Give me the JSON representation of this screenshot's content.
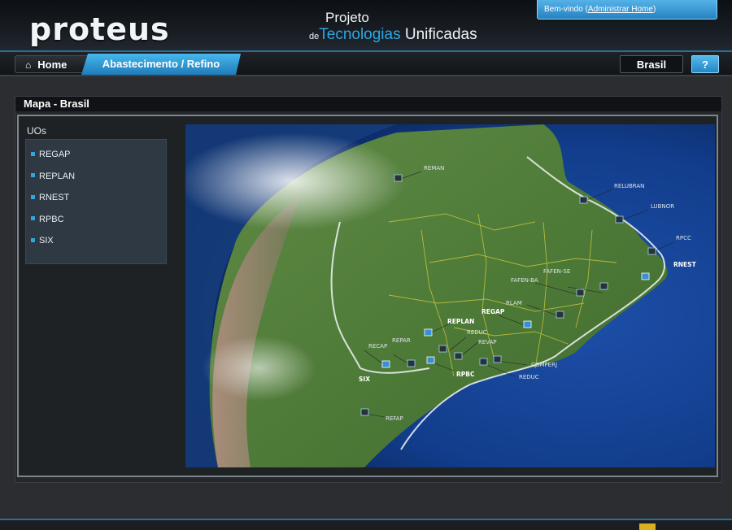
{
  "header": {
    "logo": "proteus",
    "project_line1": "Projeto",
    "project_prefix": "de",
    "project_blue": "Tecnologias",
    "project_rest": " Unificadas",
    "welcome_text": "Bem-vindo (",
    "welcome_link": "Administrar Home",
    "welcome_close": ")"
  },
  "tabs": {
    "home": "Home",
    "active": "Abastecimento / Refino",
    "region": "Brasil",
    "help": "?"
  },
  "panel": {
    "title": "Mapa - Brasil",
    "uos_label": "UOs",
    "uos": [
      "REGAP",
      "REPLAN",
      "RNEST",
      "RPBC",
      "SIX"
    ]
  },
  "map": {
    "markers": [
      "REMAN",
      "RELUBRAN",
      "LUBNOR",
      "RPCC",
      "RNEST",
      "FAFEN-SE",
      "FAFEN-BA",
      "RLAM",
      "REGAP",
      "REPLAN",
      "REDUC",
      "REVAP",
      "RECAP",
      "REPAR",
      "SIX",
      "RPBC",
      "COMPERJ",
      "REDUC",
      "REFAP"
    ]
  },
  "colors": {
    "accent": "#2fa6e2",
    "header_bg": "#0c1014",
    "panel_bg": "#24272b"
  },
  "icons": [
    "home-icon",
    "monitor-pin-icon"
  ]
}
